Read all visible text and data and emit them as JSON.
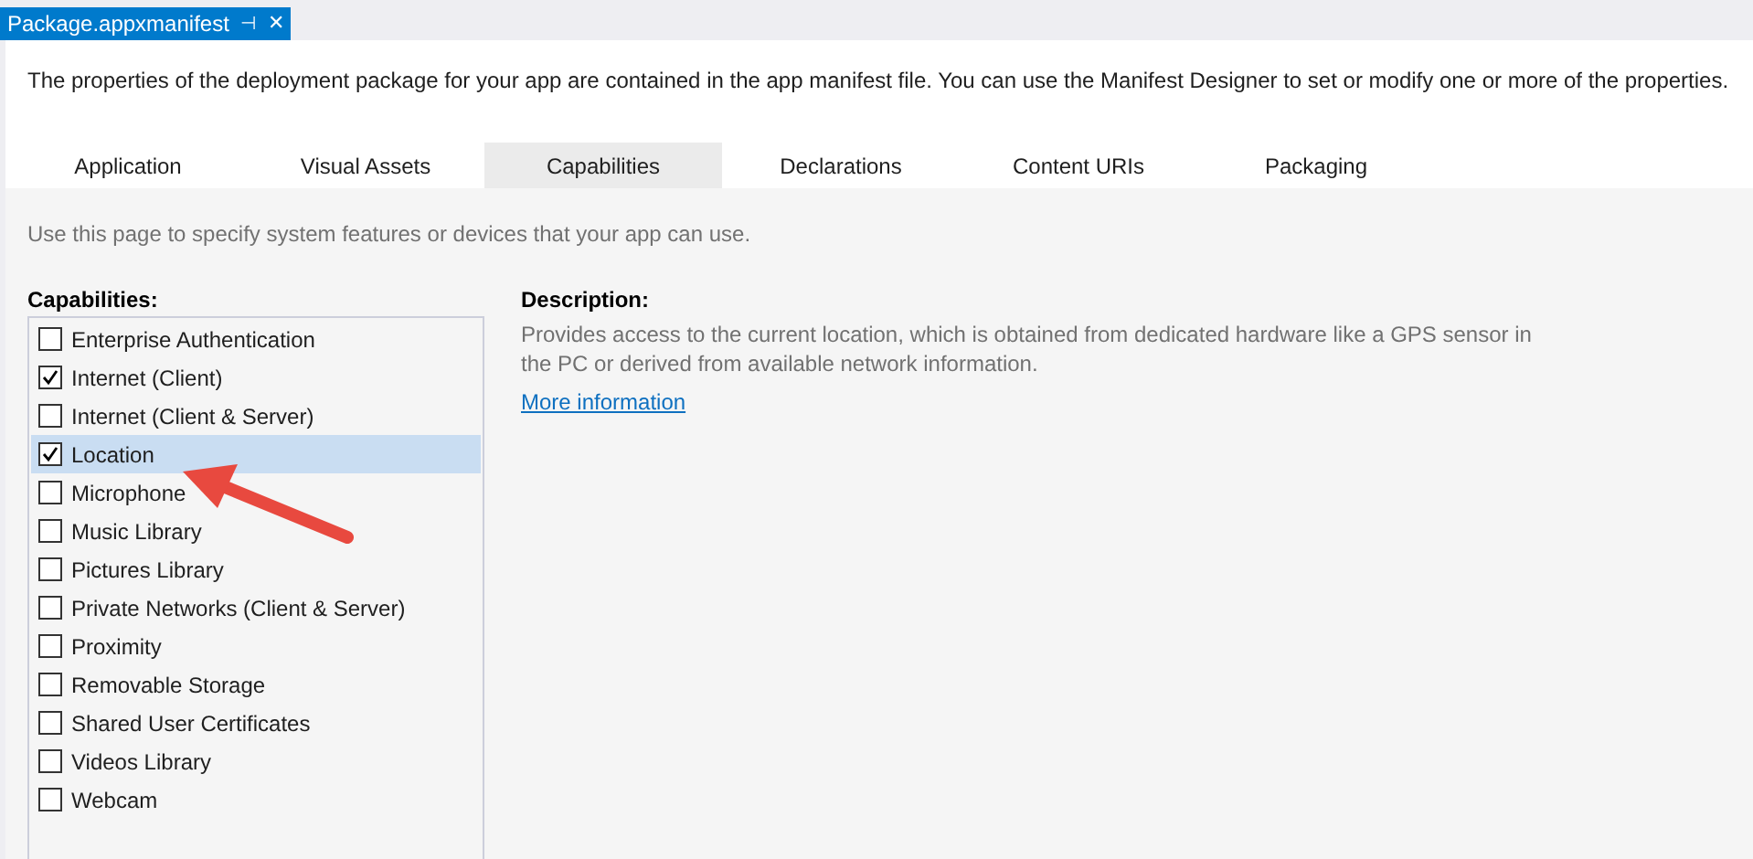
{
  "document_tab": {
    "title": "Package.appxmanifest",
    "pin_glyph": "⊣",
    "close_glyph": "✕"
  },
  "intro": "The properties of the deployment package for your app are contained in the app manifest file. You can use the Manifest Designer to set or modify one or more of the properties.",
  "tabs": [
    {
      "label": "Application",
      "selected": false
    },
    {
      "label": "Visual Assets",
      "selected": false
    },
    {
      "label": "Capabilities",
      "selected": true
    },
    {
      "label": "Declarations",
      "selected": false
    },
    {
      "label": "Content URIs",
      "selected": false
    },
    {
      "label": "Packaging",
      "selected": false
    }
  ],
  "page_hint": "Use this page to specify system features or devices that your app can use.",
  "capabilities": {
    "heading": "Capabilities:",
    "items": [
      {
        "label": "Enterprise Authentication",
        "checked": false,
        "selected": false
      },
      {
        "label": "Internet (Client)",
        "checked": true,
        "selected": false
      },
      {
        "label": "Internet (Client & Server)",
        "checked": false,
        "selected": false
      },
      {
        "label": "Location",
        "checked": true,
        "selected": true
      },
      {
        "label": "Microphone",
        "checked": false,
        "selected": false
      },
      {
        "label": "Music Library",
        "checked": false,
        "selected": false
      },
      {
        "label": "Pictures Library",
        "checked": false,
        "selected": false
      },
      {
        "label": "Private Networks (Client & Server)",
        "checked": false,
        "selected": false
      },
      {
        "label": "Proximity",
        "checked": false,
        "selected": false
      },
      {
        "label": "Removable Storage",
        "checked": false,
        "selected": false
      },
      {
        "label": "Shared User Certificates",
        "checked": false,
        "selected": false
      },
      {
        "label": "Videos Library",
        "checked": false,
        "selected": false
      },
      {
        "label": "Webcam",
        "checked": false,
        "selected": false
      }
    ]
  },
  "description": {
    "heading": "Description:",
    "text": "Provides access to the current location, which is obtained from dedicated hardware like a GPS sensor in the PC or derived from available network information.",
    "link": "More information"
  }
}
